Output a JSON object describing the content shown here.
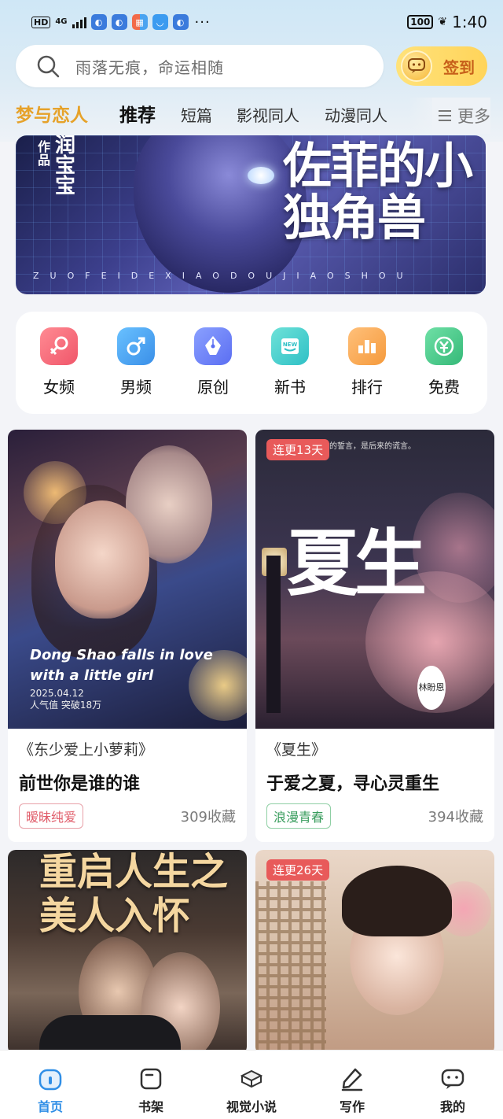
{
  "status_bar": {
    "left_chip": "HD",
    "network": "4G",
    "network_sub": "ll",
    "more": "···",
    "battery": "100",
    "time": "1:40"
  },
  "search": {
    "placeholder": "雨落无痕，命运相随"
  },
  "checkin": {
    "label": "签到"
  },
  "tabs": {
    "brand": "梦与恋人",
    "items": [
      "推荐",
      "短篇",
      "影视同人",
      "动漫同人"
    ],
    "active_index": 0,
    "more_label": "更多"
  },
  "banner": {
    "author_label": "作品",
    "author_name": "润宝宝",
    "title": "佐菲的小独角兽",
    "subtitle": "ZUOFEIDEXIAODOUJIAOSHOU"
  },
  "categories": [
    {
      "label": "女频",
      "icon": "female-icon",
      "color": "#f26b7a"
    },
    {
      "label": "男频",
      "icon": "male-icon",
      "color": "#4aa3f0"
    },
    {
      "label": "原创",
      "icon": "pen-icon",
      "color": "#5b7cf2"
    },
    {
      "label": "新书",
      "icon": "new-book-icon",
      "color": "#3fc7c7"
    },
    {
      "label": "排行",
      "icon": "ranking-icon",
      "color": "#f6a24a"
    },
    {
      "label": "免费",
      "icon": "free-yen-icon",
      "color": "#46c489"
    }
  ],
  "books": [
    {
      "cover_tag": "",
      "cover_text": "Dong Shao falls in love with a little girl",
      "cover_date": "2025.04.12",
      "cover_stats": "人气值   突破18万",
      "quote": "《东少爱上小萝莉》",
      "tagline": "前世你是谁的谁",
      "genre": "暧昧纯爱",
      "genre_color": "#e05c6a",
      "favorites": "309收藏"
    },
    {
      "cover_tag": "连更13天",
      "cover_title": "夏生",
      "cover_top": "夏的誓言，是后来的谎言。",
      "cover_author": "林盼恩",
      "quote": "《夏生》",
      "tagline": "于爱之夏，寻心灵重生",
      "genre": "浪漫青春",
      "genre_color": "#3a9d5e",
      "favorites": "394收藏"
    },
    {
      "cover_tag": "",
      "cover_title": "重启人生之美人入怀"
    },
    {
      "cover_tag": "连更26天"
    }
  ],
  "bottom_nav": [
    {
      "label": "首页",
      "icon": "home-icon",
      "active": true
    },
    {
      "label": "书架",
      "icon": "bookshelf-icon",
      "active": false
    },
    {
      "label": "视觉小说",
      "icon": "visual-novel-icon",
      "active": false
    },
    {
      "label": "写作",
      "icon": "write-icon",
      "active": false
    },
    {
      "label": "我的",
      "icon": "profile-icon",
      "active": false
    }
  ],
  "colors": {
    "accent_blue": "#2f8ee6",
    "brand_gold": "#e6a22a",
    "checkin_bg": "#ffd45a",
    "tag_red": "#e85a5a"
  }
}
